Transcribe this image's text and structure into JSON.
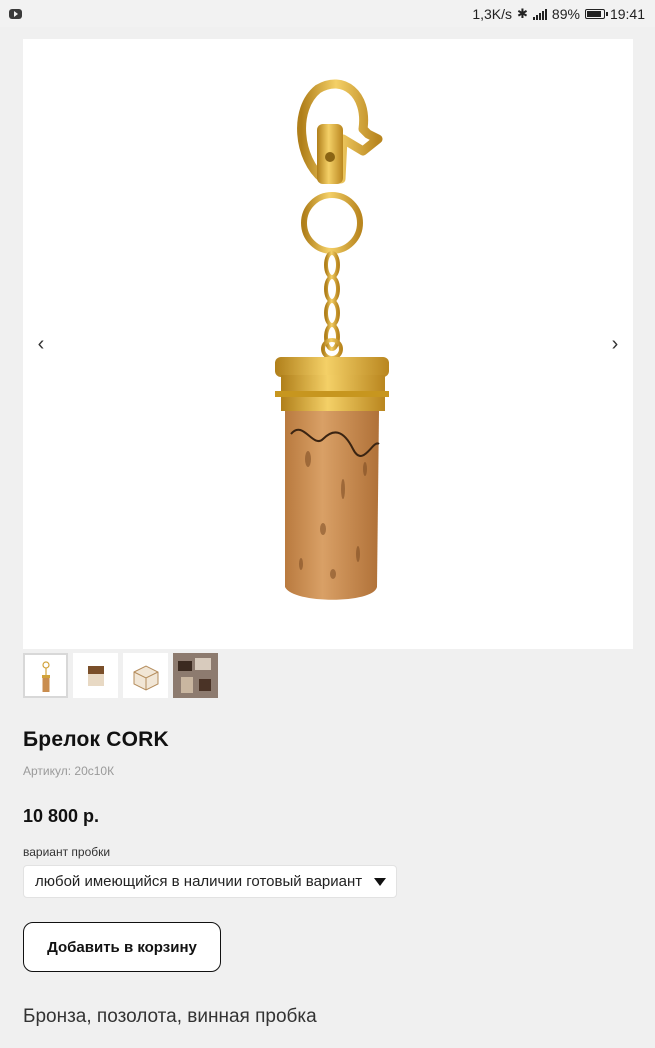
{
  "status_bar": {
    "speed": "1,3K/s",
    "battery": "89%",
    "time": "19:41",
    "icons": [
      "youtube-icon",
      "bluetooth-icon",
      "signal-icon",
      "battery-icon"
    ]
  },
  "gallery": {
    "prev_icon": "‹",
    "next_icon": "›",
    "thumbnails": [
      "cork-keychain",
      "box-closed",
      "wooden-box",
      "display-photo"
    ]
  },
  "product": {
    "title": "Брелок CORK",
    "sku": "Артикул: 20с10К",
    "price": "10 800 р.",
    "variant_label": "вариант пробки",
    "variant_value": "любой имеющийся в наличии готовый вариант",
    "add_button": "Добавить в корзину",
    "description": "Бронза, позолота, винная пробка"
  },
  "colors": {
    "background": "#f0f0f0",
    "gold": "#d9a92c",
    "cork": "#c98d4f"
  }
}
